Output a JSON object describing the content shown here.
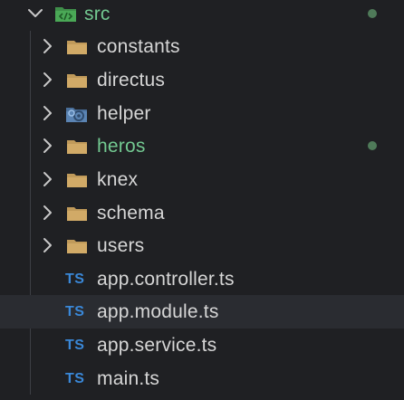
{
  "tree": {
    "root": {
      "label": "src",
      "label_color": "#73c991",
      "icon": "src-folder-icon"
    },
    "items": [
      {
        "type": "folder",
        "label": "constants",
        "icon": "folder-icon"
      },
      {
        "type": "folder",
        "label": "directus",
        "icon": "folder-icon"
      },
      {
        "type": "folder",
        "label": "helper",
        "icon": "helper-folder-icon"
      },
      {
        "type": "folder",
        "label": "heros",
        "icon": "folder-icon",
        "label_color": "#73c991",
        "modified": true
      },
      {
        "type": "folder",
        "label": "knex",
        "icon": "folder-icon"
      },
      {
        "type": "folder",
        "label": "schema",
        "icon": "folder-icon"
      },
      {
        "type": "folder",
        "label": "users",
        "icon": "folder-icon"
      },
      {
        "type": "file",
        "label": "app.controller.ts",
        "icon": "typescript-icon",
        "icon_text": "TS"
      },
      {
        "type": "file",
        "label": "app.module.ts",
        "icon": "typescript-icon",
        "icon_text": "TS",
        "selected": true
      },
      {
        "type": "file",
        "label": "app.service.ts",
        "icon": "typescript-icon",
        "icon_text": "TS"
      },
      {
        "type": "file",
        "label": "main.ts",
        "icon": "typescript-icon",
        "icon_text": "TS"
      }
    ]
  },
  "colors": {
    "background": "#1f2023",
    "text": "#d6d6d6",
    "git_modified": "#73c991",
    "folder": "#c09a5a",
    "typescript": "#3a88d8",
    "selected_row": "#2a2c31"
  }
}
